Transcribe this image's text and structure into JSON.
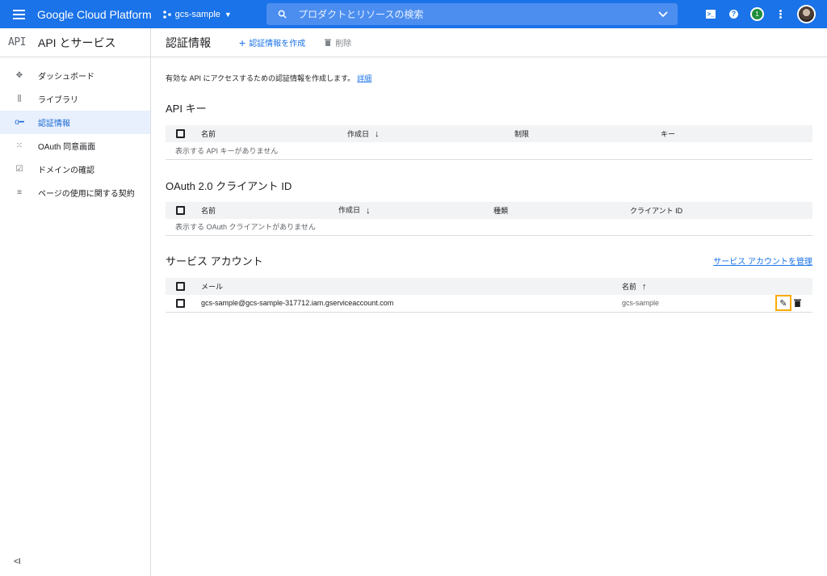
{
  "topbar": {
    "brand": "Google Cloud Platform",
    "project": "gcs-sample",
    "search_placeholder": "プロダクトとリソースの検索",
    "notification_count": "1",
    "shell_glyph": ">_",
    "help_glyph": "?"
  },
  "sidebar": {
    "logo": "API",
    "title": "API とサービス",
    "items": [
      {
        "label": "ダッシュボード",
        "icon": "dashboard-icon"
      },
      {
        "label": "ライブラリ",
        "icon": "library-icon"
      },
      {
        "label": "認証情報",
        "icon": "key-icon",
        "active": true
      },
      {
        "label": "OAuth 同意画面",
        "icon": "consent-icon"
      },
      {
        "label": "ドメインの確認",
        "icon": "domain-check-icon"
      },
      {
        "label": "ページの使用に関する契約",
        "icon": "agreement-icon"
      }
    ],
    "collapse_label": "<I"
  },
  "main": {
    "title": "認証情報",
    "create_label": "認証情報を作成",
    "delete_label": "削除",
    "intro_text": "有効な API にアクセスするための認証情報を作成します。",
    "intro_link": "詳細",
    "api_keys": {
      "title": "API キー",
      "columns": [
        "名前",
        "作成日",
        "制限",
        "キー"
      ],
      "empty": "表示する API キーがありません"
    },
    "oauth": {
      "title": "OAuth 2.0 クライアント ID",
      "columns": [
        "名前",
        "作成日",
        "種類",
        "クライアント ID"
      ],
      "empty": "表示する OAuth クライアントがありません"
    },
    "service_accounts": {
      "title": "サービス アカウント",
      "manage_link": "サービス アカウントを管理",
      "columns": [
        "メール",
        "名前"
      ],
      "rows": [
        {
          "email": "gcs-sample@gcs-sample-317712.iam.gserviceaccount.com",
          "name": "gcs-sample"
        }
      ]
    }
  },
  "colors": {
    "topbar": "#1a73e8",
    "active_bg": "#e8f0fe",
    "highlight": "#f9ab00"
  }
}
